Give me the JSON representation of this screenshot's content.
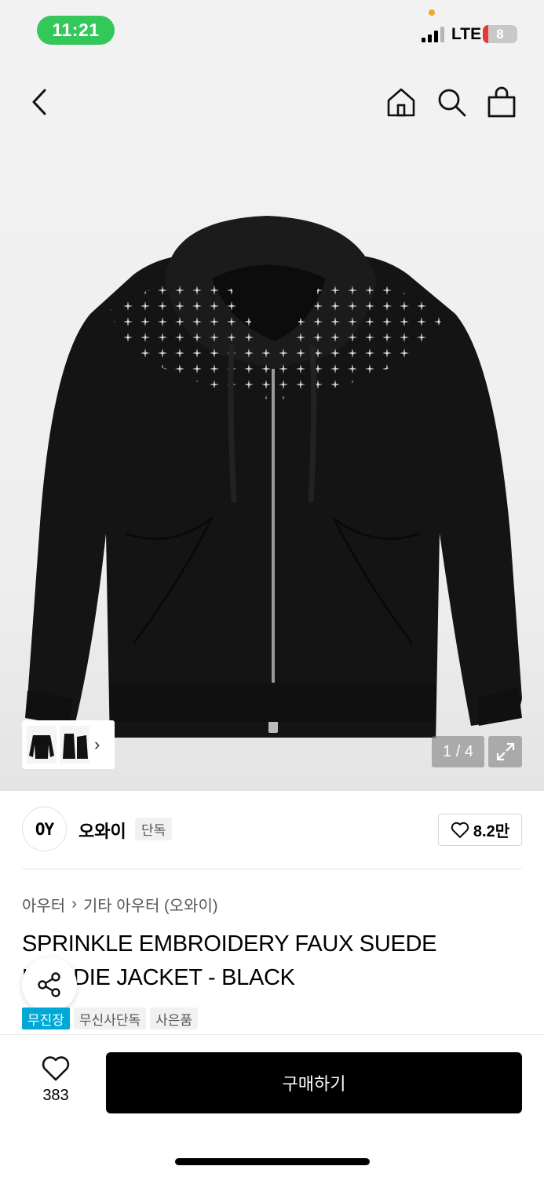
{
  "status_bar": {
    "time": "11:21",
    "network": "LTE",
    "battery": "8"
  },
  "nav": {
    "icons": [
      "back-icon",
      "home-icon",
      "search-icon",
      "shopping-bag-icon"
    ]
  },
  "gallery": {
    "page_indicator": "1 / 4",
    "thumb_arrow": "›"
  },
  "brand": {
    "logo_text": "OY",
    "name": "오와이",
    "badge": "단독",
    "likes": "8.2만"
  },
  "breadcrumb": {
    "category": "아우터",
    "separator": "›",
    "subcategory": "기타 아우터 (오와이)"
  },
  "product": {
    "title": "SPRINKLE EMBROIDERY FAUX SUEDE HOODIE JACKET - BLACK"
  },
  "tags": [
    "무진장",
    "무신사단독",
    "사은품"
  ],
  "bottom_bar": {
    "wish_count": "383",
    "buy_label": "구매하기"
  },
  "colors": {
    "status_green": "#34c759",
    "tag_blue": "#00a8d6",
    "buy_black": "#000000"
  }
}
